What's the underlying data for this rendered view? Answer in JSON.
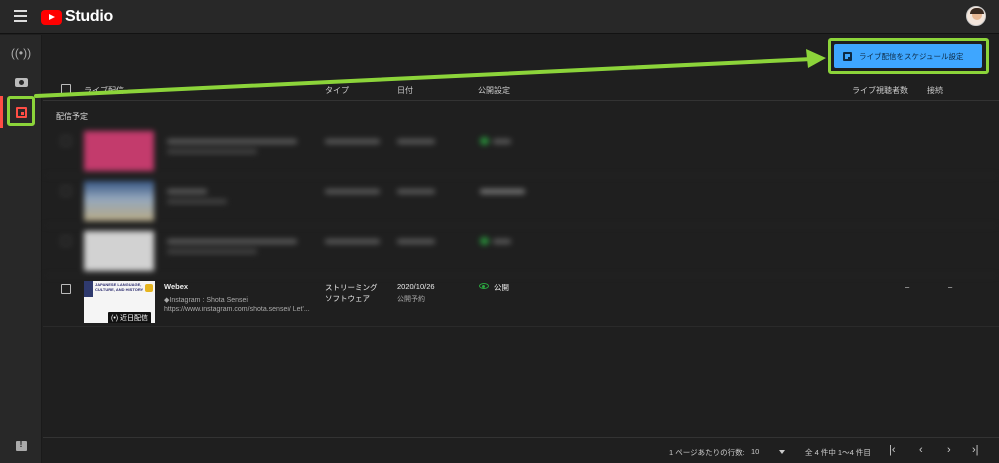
{
  "app": {
    "logo_text": "Studio"
  },
  "toolbar": {
    "schedule_label": "ライブ配信をスケジュール設定"
  },
  "table": {
    "headers": {
      "live": "ライブ配信",
      "type": "タイプ",
      "date": "日付",
      "visibility": "公開設定",
      "viewers": "ライブ視聴者数",
      "connection": "接続"
    },
    "section_label": "配信予定",
    "row": {
      "title": "Webex",
      "desc1": "◆Instagram : Shota Sensei",
      "desc2": "https://www.instagram.com/shota.sensei/ Let'...",
      "type_line1": "ストリーミング",
      "type_line2": "ソフトウェア",
      "date": "2020/10/26",
      "date_sub": "公開予約",
      "visibility": "公開",
      "viewers": "–",
      "connection": "–",
      "thumb_line1": "JAPANESE LANGUAGE,",
      "thumb_line2": "CULTURE, AND HISTORY",
      "thumb_badge": "(•) 近日配信"
    }
  },
  "footer": {
    "rows_per_page_label": "1 ページあたりの行数:",
    "rows_per_page_value": "10",
    "range": "全 4 件中 1〜4 件目",
    "first": "|‹",
    "prev": "‹",
    "next": "›",
    "last": "›|"
  },
  "colors": {
    "accent": "#3ea6ff",
    "highlight": "#8cd43a",
    "active": "#ff4e45",
    "public": "#2ba640"
  }
}
